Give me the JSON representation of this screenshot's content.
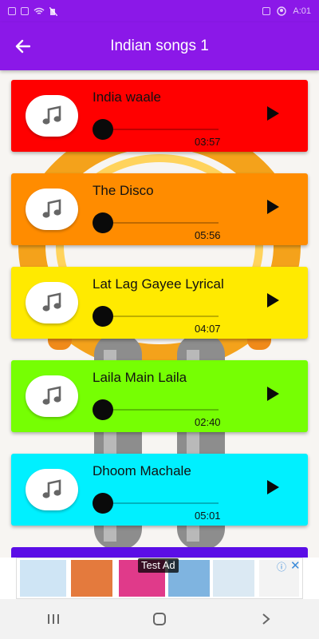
{
  "status_bar": {
    "time": "A:01",
    "left_icons": [
      "sim-icon",
      "sms-icon",
      "wifi-icon",
      "mute-icon"
    ],
    "right_icons": [
      "lock-icon",
      "account-icon"
    ]
  },
  "app_bar": {
    "title": "Indian songs 1",
    "back_icon": "back-arrow-icon"
  },
  "colors": {
    "app_bar": "#8b18e8",
    "card1": "#ff0000",
    "card2": "#ff8c00",
    "card3": "#ffea00",
    "card4": "#76ff03",
    "card5": "#00f0ff",
    "card6": "#5b0ee6"
  },
  "songs": [
    {
      "title": "India waale",
      "duration": "03:57",
      "progress": 0
    },
    {
      "title": "The Disco",
      "duration": "05:56",
      "progress": 0
    },
    {
      "title": "Lat Lag Gayee Lyrical",
      "duration": "04:07",
      "progress": 0
    },
    {
      "title": "Laila Main Laila",
      "duration": "02:40",
      "progress": 0
    },
    {
      "title": "Dhoom Machale",
      "duration": "05:01",
      "progress": 0
    }
  ],
  "ad": {
    "label": "Test Ad",
    "info_icon": "info-icon",
    "close_icon": "close-icon"
  },
  "nav_bar": {
    "icons": [
      "recents-icon",
      "home-icon",
      "back-icon"
    ]
  }
}
